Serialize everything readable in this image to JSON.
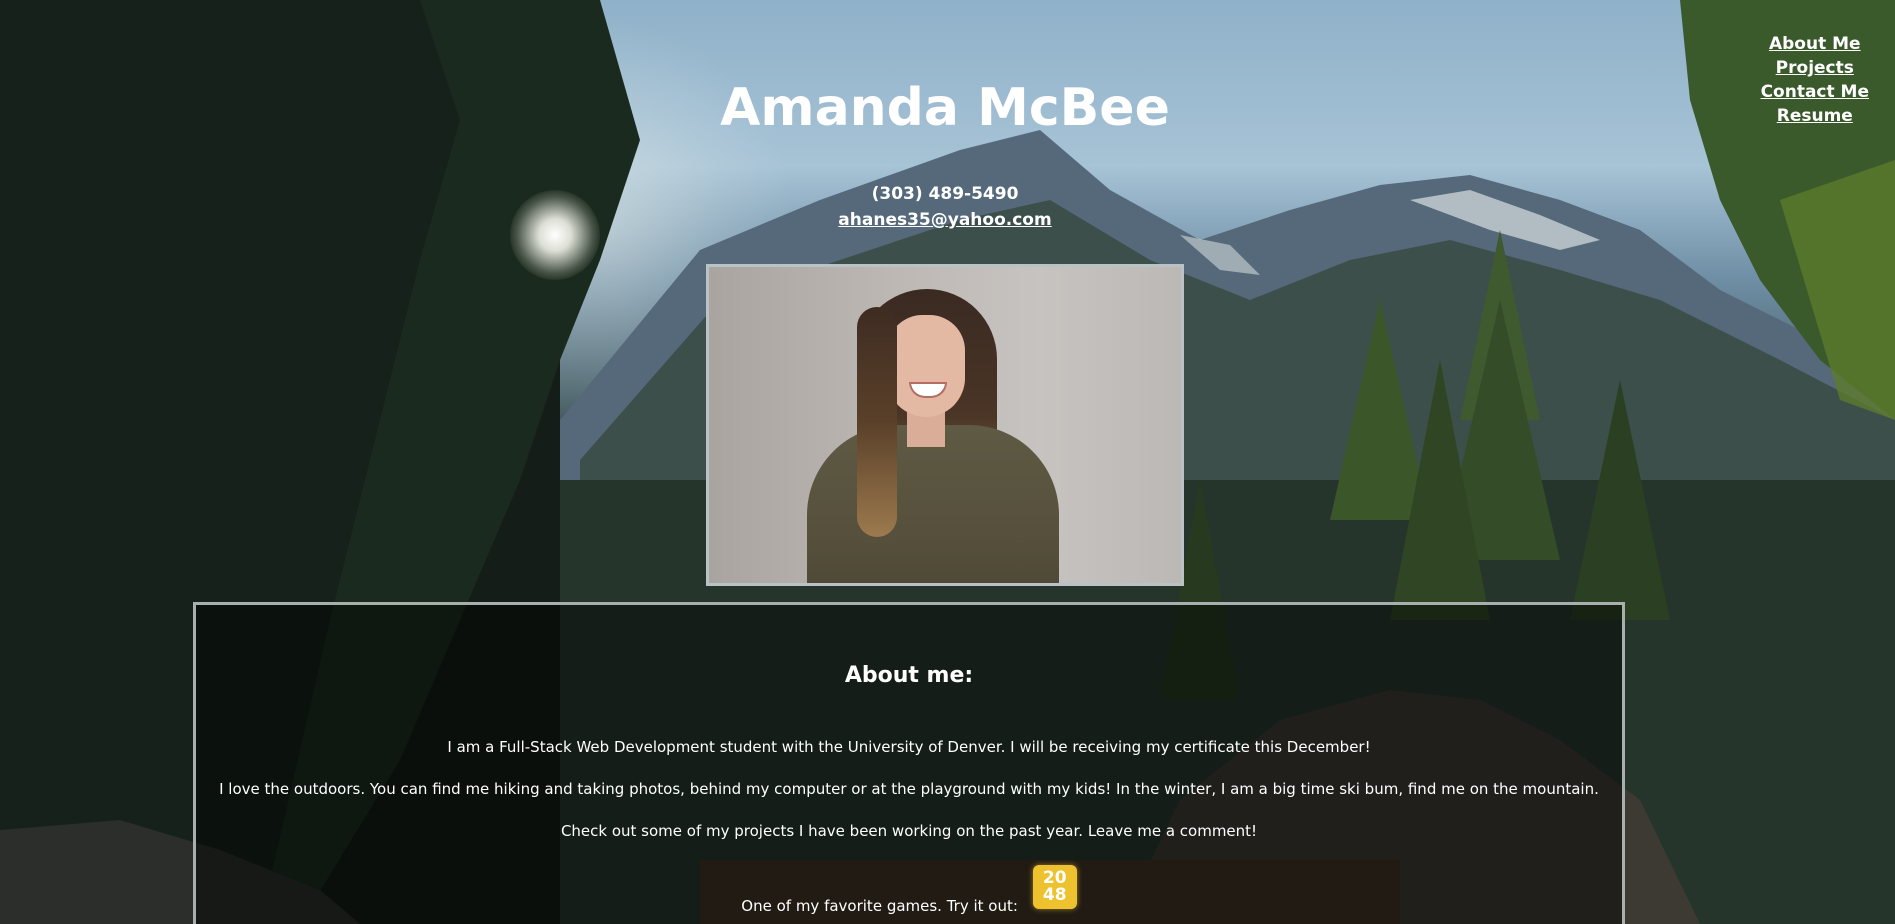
{
  "nav": {
    "items": [
      {
        "label": "About Me"
      },
      {
        "label": "Projects"
      },
      {
        "label": "Contact Me"
      },
      {
        "label": "Resume"
      }
    ]
  },
  "header": {
    "name": "Amanda McBee",
    "phone": "(303) 489-5490",
    "email": "ahanes35@yahoo.com"
  },
  "about": {
    "heading": "About me:",
    "paragraphs": [
      "I am a Full-Stack Web Development student with the University of Denver. I will be receiving my certificate this December!",
      "I love the outdoors. You can find me hiking and taking photos, behind my computer or at the playground with my kids! In the winter, I am a big time ski bum, find me on the mountain.",
      "Check out some of my projects I have been working on the past year. Leave me a comment!"
    ],
    "game_prompt": "One of my favorite games. Try it out:",
    "game_tile": {
      "top": "20",
      "bottom": "48",
      "color": "#edc22e"
    }
  },
  "colors": {
    "text": "#ffffff",
    "panel_border": "#a9aeae",
    "photo_border": "#b9c2c4"
  }
}
